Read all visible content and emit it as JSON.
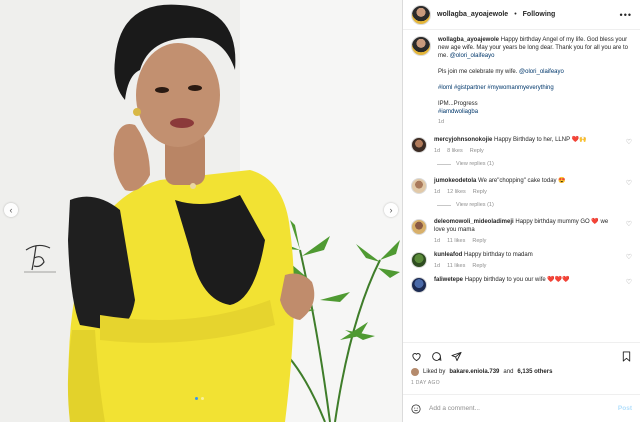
{
  "header": {
    "username": "wollagba_ayoajewole",
    "separator": "•",
    "follow_status": "Following",
    "more_icon": "ellipsis-icon"
  },
  "caption": {
    "username": "wollagba_ayoajewole",
    "line1": "Happy birthday Angel of my life. God bless your new age wife. May your years be long dear. Thank you for all you are to me.",
    "mention1": "@olori_olaifeayo",
    "line2": "Pls join me celebrate my wife.",
    "mention2": "@olori_olaifeayo",
    "hashtags": "#loml #gistpartner #mywomanmyeverything",
    "line3": "IPM...Progress",
    "hashtag2": "#iamdwoliagba",
    "time": "1d"
  },
  "comments": [
    {
      "username": "mercyjohnsonokojie",
      "text": "Happy Birthday to her, LLNP ❤️🙌",
      "time": "1d",
      "likes": "8 likes",
      "reply": "Reply",
      "view_replies": "View replies (1)"
    },
    {
      "username": "jumokeodetola",
      "text": "We are\"chopping\" cake today 😍",
      "time": "1d",
      "likes": "12 likes",
      "reply": "Reply",
      "view_replies": "View replies (1)"
    },
    {
      "username": "deleomowoli_mideoladimeji",
      "text": "Happy birthday mummy GO ❤️ we love you mama",
      "time": "1d",
      "likes": "11 likes",
      "reply": "Reply",
      "view_replies": ""
    },
    {
      "username": "kunleafod",
      "text": "Happy birthday to madam",
      "time": "1d",
      "likes": "11 likes",
      "reply": "Reply",
      "view_replies": ""
    },
    {
      "username": "faliwetepe",
      "text": "Happy birthday to you our wife ❤️❤️❤️",
      "time": "",
      "likes": "",
      "reply": "",
      "view_replies": ""
    }
  ],
  "actions": {
    "liked_prefix": "Liked by",
    "liked_user": "bakare.eniola.739",
    "liked_and": "and",
    "liked_others": "6,135 others",
    "date": "1 DAY AGO"
  },
  "add_comment": {
    "placeholder": "Add a comment...",
    "post_label": "Post"
  },
  "media": {
    "prev_icon": "chevron-left-icon",
    "next_icon": "chevron-right-icon",
    "slides": 2,
    "active_slide": 1
  },
  "colors": {
    "link": "#00376b",
    "muted": "#8e8e8e",
    "post_disabled": "#b2dffc",
    "dress": "#f2e233",
    "active_dot": "#3897f0"
  }
}
